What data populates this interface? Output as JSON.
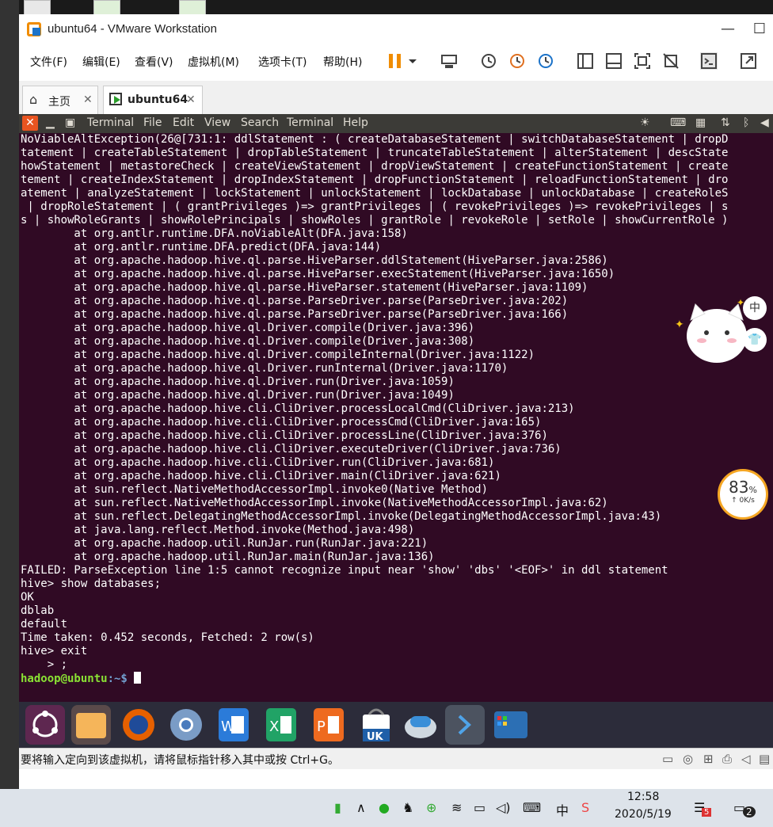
{
  "window": {
    "title": "ubuntu64 - VMware Workstation"
  },
  "menubar": {
    "items": [
      "文件(F)",
      "编辑(E)",
      "查看(V)",
      "虚拟机(M)",
      "选项卡(T)",
      "帮助(H)"
    ]
  },
  "tabs": [
    {
      "label": "主页"
    },
    {
      "label": "ubuntu64"
    }
  ],
  "guest_menu": {
    "items": [
      "Terminal",
      "File",
      "Edit",
      "View",
      "Search",
      "Terminal",
      "Help"
    ]
  },
  "terminal": {
    "lines": [
      "NoViableAltException(26@[731:1: ddlStatement : ( createDatabaseStatement | switchDatabaseStatement | dropD",
      "tatement | createTableStatement | dropTableStatement | truncateTableStatement | alterStatement | descState",
      "howStatement | metastoreCheck | createViewStatement | dropViewStatement | createFunctionStatement | create",
      "tement | createIndexStatement | dropIndexStatement | dropFunctionStatement | reloadFunctionStatement | dro",
      "atement | analyzeStatement | lockStatement | unlockStatement | lockDatabase | unlockDatabase | createRoleS",
      " | dropRoleStatement | ( grantPrivileges )=> grantPrivileges | ( revokePrivileges )=> revokePrivileges | s",
      "s | showRoleGrants | showRolePrincipals | showRoles | grantRole | revokeRole | setRole | showCurrentRole )",
      "        at org.antlr.runtime.DFA.noViableAlt(DFA.java:158)",
      "        at org.antlr.runtime.DFA.predict(DFA.java:144)",
      "        at org.apache.hadoop.hive.ql.parse.HiveParser.ddlStatement(HiveParser.java:2586)",
      "        at org.apache.hadoop.hive.ql.parse.HiveParser.execStatement(HiveParser.java:1650)",
      "        at org.apache.hadoop.hive.ql.parse.HiveParser.statement(HiveParser.java:1109)",
      "        at org.apache.hadoop.hive.ql.parse.ParseDriver.parse(ParseDriver.java:202)",
      "        at org.apache.hadoop.hive.ql.parse.ParseDriver.parse(ParseDriver.java:166)",
      "        at org.apache.hadoop.hive.ql.Driver.compile(Driver.java:396)",
      "        at org.apache.hadoop.hive.ql.Driver.compile(Driver.java:308)",
      "        at org.apache.hadoop.hive.ql.Driver.compileInternal(Driver.java:1122)",
      "        at org.apache.hadoop.hive.ql.Driver.runInternal(Driver.java:1170)",
      "        at org.apache.hadoop.hive.ql.Driver.run(Driver.java:1059)",
      "        at org.apache.hadoop.hive.ql.Driver.run(Driver.java:1049)",
      "        at org.apache.hadoop.hive.cli.CliDriver.processLocalCmd(CliDriver.java:213)",
      "        at org.apache.hadoop.hive.cli.CliDriver.processCmd(CliDriver.java:165)",
      "        at org.apache.hadoop.hive.cli.CliDriver.processLine(CliDriver.java:376)",
      "        at org.apache.hadoop.hive.cli.CliDriver.executeDriver(CliDriver.java:736)",
      "        at org.apache.hadoop.hive.cli.CliDriver.run(CliDriver.java:681)",
      "        at org.apache.hadoop.hive.cli.CliDriver.main(CliDriver.java:621)",
      "        at sun.reflect.NativeMethodAccessorImpl.invoke0(Native Method)",
      "        at sun.reflect.NativeMethodAccessorImpl.invoke(NativeMethodAccessorImpl.java:62)",
      "        at sun.reflect.DelegatingMethodAccessorImpl.invoke(DelegatingMethodAccessorImpl.java:43)",
      "        at java.lang.reflect.Method.invoke(Method.java:498)",
      "        at org.apache.hadoop.util.RunJar.run(RunJar.java:221)",
      "        at org.apache.hadoop.util.RunJar.main(RunJar.java:136)",
      "FAILED: ParseException line 1:5 cannot recognize input near 'show' 'dbs' '<EOF>' in ddl statement",
      "hive> show databases;",
      "OK",
      "dblab",
      "default",
      "Time taken: 0.452 seconds, Fetched: 2 row(s)",
      "hive> exit",
      "    > ;"
    ],
    "prompt_user": "hadoop@ubuntu",
    "prompt_path": ":~$ "
  },
  "speed_widget": {
    "percent": "83",
    "percent_sign": "%",
    "rate": "↑ 0K/s"
  },
  "side_bubbles": {
    "lang": "中"
  },
  "status_bar": {
    "text": "要将输入定向到该虚拟机，请将鼠标指针移入其中或按 Ctrl+G。"
  },
  "taskbar": {
    "time": "12:58",
    "date": "2020/5/19",
    "ime": "中",
    "notification_badge": "5",
    "action_center_count": "2"
  },
  "dock_apps": [
    "ubuntu-dash-icon",
    "files-icon",
    "firefox-icon",
    "chromium-icon",
    "writer-icon",
    "calc-icon",
    "impress-icon",
    "software-center-icon",
    "settings-icon",
    "terminal-icon",
    "workspace-icon"
  ],
  "colors": {
    "terminal_bg": "#300a24",
    "prompt_green": "#8ae234",
    "prompt_blue": "#729fcf",
    "ubuntu_orange": "#e95420"
  }
}
